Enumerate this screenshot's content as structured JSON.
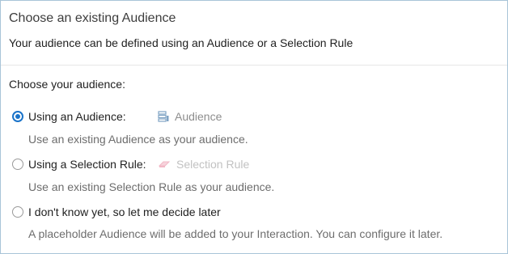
{
  "header": {
    "title": "Choose an existing Audience",
    "subtitle": "Your audience can be defined using an Audience or a Selection Rule"
  },
  "main": {
    "section_label": "Choose your audience:",
    "options": [
      {
        "label": "Using an Audience:",
        "selected": true,
        "picker_label": "Audience",
        "picker_icon": "audience-list-icon",
        "description": "Use an existing Audience as your audience."
      },
      {
        "label": "Using a Selection Rule:",
        "selected": false,
        "picker_label": "Selection Rule",
        "picker_icon": "eraser-rule-icon",
        "description": "Use an existing Selection Rule as your audience."
      },
      {
        "label": "I don't know yet, so let me decide later",
        "selected": false,
        "description": "A placeholder Audience will be added to your Interaction. You can configure it later."
      }
    ]
  },
  "colors": {
    "accent": "#1a73c9",
    "border": "#a9c4d8",
    "muted_text": "#6d6d6d",
    "icon_audience": "#7fa3c4",
    "icon_rule": "#f2b8c6"
  }
}
